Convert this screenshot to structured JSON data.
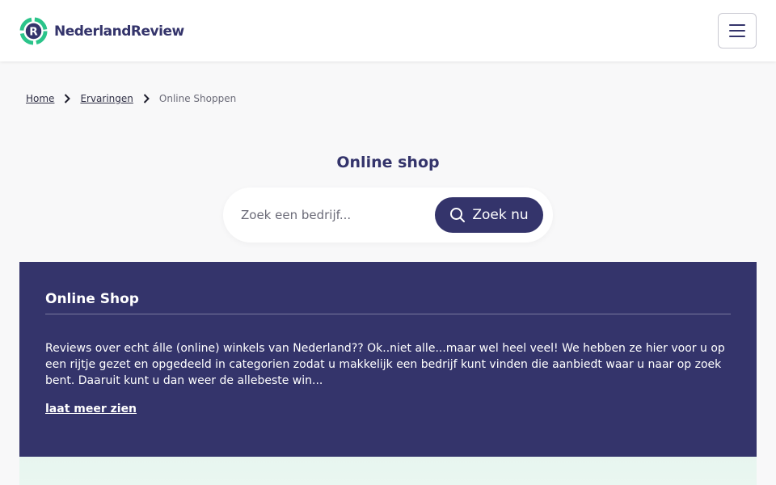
{
  "header": {
    "logo_text": "NederlandReview",
    "logo_letter": "R",
    "menu_icon": "hamburger-icon"
  },
  "breadcrumb": {
    "items": [
      "Home",
      "Ervaringen"
    ],
    "current": "Online Shoppen",
    "separator_icon": "chevron-right-icon"
  },
  "main": {
    "title": "Online shop"
  },
  "search": {
    "placeholder": "Zoek een bedrijf...",
    "button_label": "Zoek nu",
    "button_icon": "search-icon"
  },
  "card": {
    "title": "Online Shop",
    "text": "Reviews over echt álle (online) winkels van Nederland?? Ok..niet alle...maar wel heel veel! We hebben ze hier voor u op een rijtje gezet en opgedeeld in categorien zodat u makkelijk een bedrijf kunt vinden die aanbiedt waar u naar op zoek bent. Daaruit kunt u dan weer de allebeste win...",
    "more_label": "laat meer zien"
  },
  "colors": {
    "primary": "#34346b",
    "accent_green": "#2bc48a",
    "background": "#f8f8f9"
  }
}
